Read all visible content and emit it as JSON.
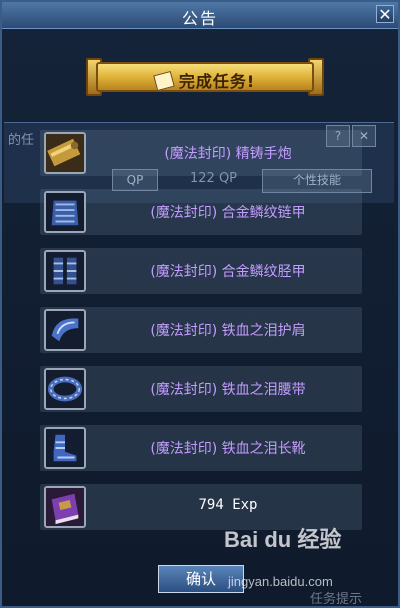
{
  "dialog": {
    "title": "公告",
    "close_label": "✕"
  },
  "background": {
    "left_text": "的任",
    "qp_label": "QP",
    "qp_value": "122 QP",
    "skill_button": "个性技能",
    "help_symbol": "?",
    "bg_close": "✕"
  },
  "banner": {
    "label": "完成任务!"
  },
  "rewards": [
    {
      "icon": "cannon-gauntlet-icon",
      "label": "(魔法封印) 精铸手炮"
    },
    {
      "icon": "chain-armor-icon",
      "label": "(魔法封印) 合金鳞纹链甲"
    },
    {
      "icon": "greaves-icon",
      "label": "(魔法封印) 合金鳞纹胫甲"
    },
    {
      "icon": "shoulder-guard-icon",
      "label": "(魔法封印) 铁血之泪护肩"
    },
    {
      "icon": "belt-icon",
      "label": "(魔法封印) 铁血之泪腰带"
    },
    {
      "icon": "boots-icon",
      "label": "(魔法封印) 铁血之泪长靴"
    },
    {
      "icon": "exp-book-icon",
      "label": "794 Exp"
    }
  ],
  "confirm": {
    "label": "确认"
  },
  "watermark": {
    "brand": "Bai du 经验",
    "url": "jingyan.baidu.com"
  },
  "footer": {
    "hint": "任务提示"
  },
  "colors": {
    "item_text": "#c39cff",
    "banner_gold": "#e0b33a",
    "frame_blue": "#3b5c86"
  }
}
